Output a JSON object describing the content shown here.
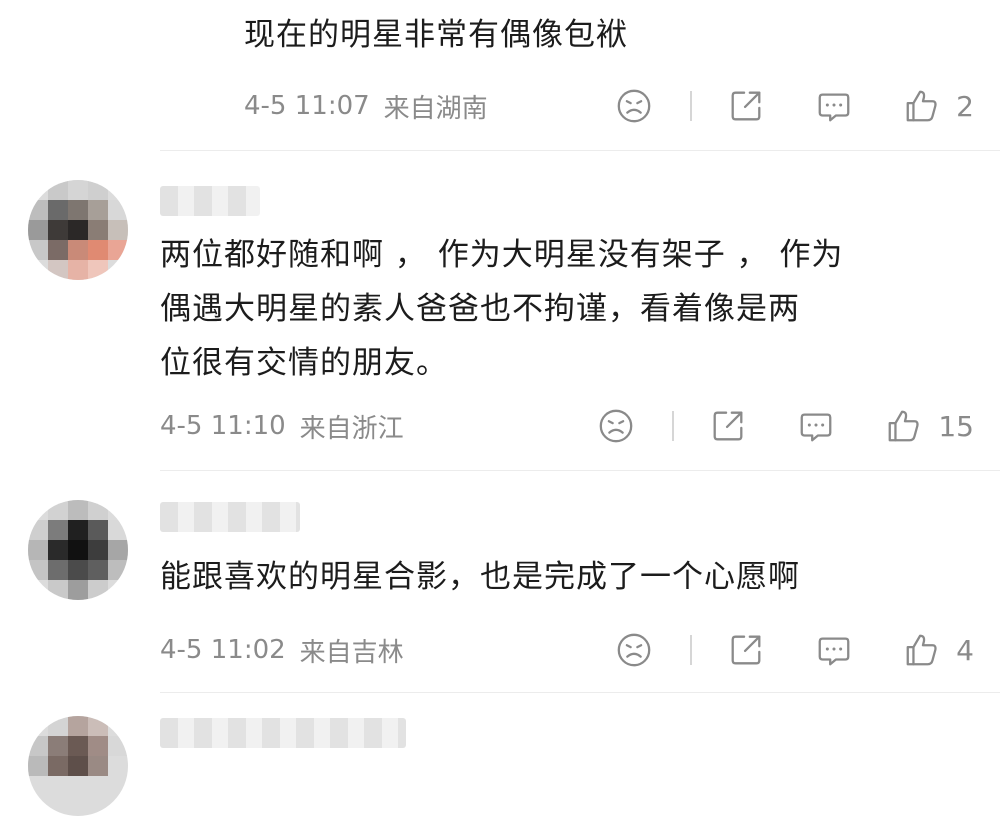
{
  "comments": [
    {
      "text_lines": [
        "现在的明星非常有偶像包袱"
      ],
      "date": "4-5",
      "time": "11:07",
      "location": "来自湖南",
      "likes": "2"
    },
    {
      "text_lines": [
        "两位都好随和啊 ， 作为大明星没有架子 ， 作为",
        "偶遇大明星的素人爸爸也不拘谨，看着像是两",
        "位很有交情的朋友。"
      ],
      "date": "4-5",
      "time": "11:10",
      "location": "来自浙江",
      "likes": "15"
    },
    {
      "text_lines": [
        "能跟喜欢的明星合影，也是完成了一个心愿啊"
      ],
      "date": "4-5",
      "time": "11:02",
      "location": "来自吉林",
      "likes": "4"
    }
  ],
  "icons": {
    "dislike": "frown-face-icon",
    "share": "share-icon",
    "reply": "comment-bubble-icon",
    "like": "thumbs-up-icon"
  },
  "colors": {
    "text": "#1c1c1c",
    "meta": "#8a8a8a",
    "icon": "#8a8a8a",
    "divider": "#ececec"
  }
}
